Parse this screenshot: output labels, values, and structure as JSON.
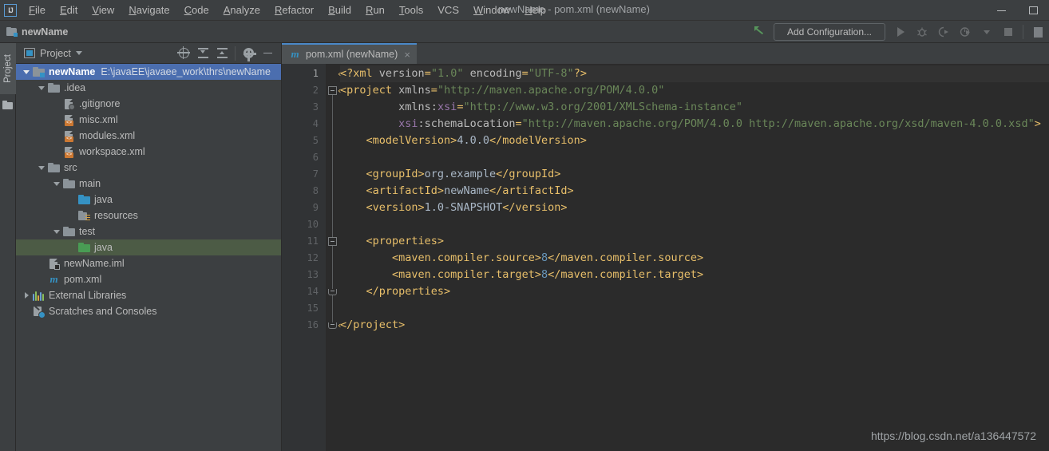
{
  "window": {
    "title": "newName - pom.xml (newName)",
    "logo": "intellij-idea-logo",
    "minimize": "−",
    "maximize": "□"
  },
  "menubar": {
    "items": [
      {
        "pre": "",
        "mn": "F",
        "post": "ile"
      },
      {
        "pre": "",
        "mn": "E",
        "post": "dit"
      },
      {
        "pre": "",
        "mn": "V",
        "post": "iew"
      },
      {
        "pre": "",
        "mn": "N",
        "post": "avigate"
      },
      {
        "pre": "",
        "mn": "C",
        "post": "ode"
      },
      {
        "pre": "",
        "mn": "A",
        "post": "nalyze"
      },
      {
        "pre": "",
        "mn": "R",
        "post": "efactor"
      },
      {
        "pre": "",
        "mn": "B",
        "post": "uild"
      },
      {
        "pre": "",
        "mn": "R",
        "post": "un"
      },
      {
        "pre": "",
        "mn": "T",
        "post": "ools"
      },
      {
        "pre": "VCS",
        "mn": "",
        "post": ""
      },
      {
        "pre": "",
        "mn": "W",
        "post": "indow"
      },
      {
        "pre": "",
        "mn": "H",
        "post": "elp"
      }
    ]
  },
  "navbar": {
    "breadcrumb": "newName",
    "add_configuration_label": "Add Configuration...",
    "icons": [
      "run-icon",
      "debug-icon",
      "run-with-coverage-icon",
      "profiler-icon",
      "chevron-down-icon",
      "stop-icon"
    ]
  },
  "project_panel": {
    "title": "Project",
    "toolbar_icons": [
      "locate-target-icon",
      "expand-all-icon",
      "collapse-all-icon",
      "settings-gear-icon",
      "hide-panel-icon"
    ],
    "tool_window_tab": "Project",
    "tree": [
      {
        "indent": 0,
        "twisty": "down",
        "icon": "module-icon",
        "label": "newName",
        "bold": true,
        "path": "E:\\javaEE\\javaee_work\\thrs\\newName",
        "state": "selected-blue"
      },
      {
        "indent": 1,
        "twisty": "down",
        "icon": "folder-icon",
        "label": ".idea",
        "state": "none"
      },
      {
        "indent": 2,
        "twisty": "none",
        "icon": "gitignore-file-icon",
        "label": ".gitignore",
        "state": "none"
      },
      {
        "indent": 2,
        "twisty": "none",
        "icon": "xml-file-icon",
        "label": "misc.xml",
        "state": "none"
      },
      {
        "indent": 2,
        "twisty": "none",
        "icon": "xml-file-icon",
        "label": "modules.xml",
        "state": "none"
      },
      {
        "indent": 2,
        "twisty": "none",
        "icon": "xml-file-icon",
        "label": "workspace.xml",
        "state": "none"
      },
      {
        "indent": 1,
        "twisty": "down",
        "icon": "folder-icon",
        "label": "src",
        "state": "none"
      },
      {
        "indent": 2,
        "twisty": "down",
        "icon": "folder-icon",
        "label": "main",
        "state": "none"
      },
      {
        "indent": 3,
        "twisty": "none",
        "icon": "source-folder-icon",
        "label": "java",
        "state": "none"
      },
      {
        "indent": 3,
        "twisty": "none",
        "icon": "resources-folder-icon",
        "label": "resources",
        "state": "none"
      },
      {
        "indent": 2,
        "twisty": "down",
        "icon": "folder-icon",
        "label": "test",
        "state": "none"
      },
      {
        "indent": 3,
        "twisty": "none",
        "icon": "test-source-folder-icon",
        "label": "java",
        "state": "selected-green"
      },
      {
        "indent": 1,
        "twisty": "none",
        "icon": "iml-file-icon",
        "label": "newName.iml",
        "state": "none"
      },
      {
        "indent": 1,
        "twisty": "none",
        "icon": "maven-pom-icon",
        "label": "pom.xml",
        "state": "none"
      },
      {
        "indent": 0,
        "twisty": "right",
        "icon": "external-libraries-icon",
        "label": "External Libraries",
        "state": "none"
      },
      {
        "indent": 0,
        "twisty": "none",
        "icon": "scratches-icon",
        "label": "Scratches and Consoles",
        "state": "none"
      }
    ]
  },
  "editor": {
    "tab": {
      "icon": "maven-pom-icon",
      "label": "pom.xml (newName)",
      "close": "×"
    },
    "line_numbers": [
      "1",
      "2",
      "3",
      "4",
      "5",
      "6",
      "7",
      "8",
      "9",
      "10",
      "11",
      "12",
      "13",
      "14",
      "15",
      "16"
    ],
    "active_line": 1,
    "lines": [
      {
        "n": 1,
        "indent": 0,
        "parts": [
          {
            "t": "pi",
            "v": "<?xml "
          },
          {
            "t": "attr",
            "v": "version"
          },
          {
            "t": "pi",
            "v": "="
          },
          {
            "t": "str",
            "v": "\"1.0\""
          },
          {
            "t": "pi",
            "v": " "
          },
          {
            "t": "attr",
            "v": "encoding"
          },
          {
            "t": "pi",
            "v": "="
          },
          {
            "t": "str",
            "v": "\"UTF-8\""
          },
          {
            "t": "pi",
            "v": "?>"
          }
        ]
      },
      {
        "n": 2,
        "indent": 0,
        "parts": [
          {
            "t": "tag",
            "v": "<project "
          },
          {
            "t": "attr",
            "v": "xmlns"
          },
          {
            "t": "tag",
            "v": "="
          },
          {
            "t": "str",
            "v": "\"http://maven.apache.org/POM/4.0.0\""
          }
        ]
      },
      {
        "n": 3,
        "indent": 0,
        "parts": [
          {
            "t": "txt",
            "v": "         "
          },
          {
            "t": "attr",
            "v": "xmlns:"
          },
          {
            "t": "ns",
            "v": "xsi"
          },
          {
            "t": "tag",
            "v": "="
          },
          {
            "t": "str",
            "v": "\"http://www.w3.org/2001/XMLSchema-instance\""
          }
        ]
      },
      {
        "n": 4,
        "indent": 0,
        "parts": [
          {
            "t": "txt",
            "v": "         "
          },
          {
            "t": "ns",
            "v": "xsi"
          },
          {
            "t": "attr",
            "v": ":schemaLocation"
          },
          {
            "t": "tag",
            "v": "="
          },
          {
            "t": "str",
            "v": "\"http://maven.apache.org/POM/4.0.0 http://maven.apache.org/xsd/maven-4.0.0.xsd\""
          },
          {
            "t": "tag",
            "v": ">"
          }
        ]
      },
      {
        "n": 5,
        "indent": 0,
        "parts": [
          {
            "t": "txt",
            "v": "    "
          },
          {
            "t": "tag",
            "v": "<modelVersion>"
          },
          {
            "t": "txt",
            "v": "4.0.0"
          },
          {
            "t": "tag",
            "v": "</modelVersion>"
          }
        ]
      },
      {
        "n": 6,
        "indent": 0,
        "parts": [
          {
            "t": "txt",
            "v": ""
          }
        ]
      },
      {
        "n": 7,
        "indent": 0,
        "parts": [
          {
            "t": "txt",
            "v": "    "
          },
          {
            "t": "tag",
            "v": "<groupId>"
          },
          {
            "t": "txt",
            "v": "org.example"
          },
          {
            "t": "tag",
            "v": "</groupId>"
          }
        ]
      },
      {
        "n": 8,
        "indent": 0,
        "parts": [
          {
            "t": "txt",
            "v": "    "
          },
          {
            "t": "tag",
            "v": "<artifactId>"
          },
          {
            "t": "txt",
            "v": "newName"
          },
          {
            "t": "tag",
            "v": "</artifactId>"
          }
        ]
      },
      {
        "n": 9,
        "indent": 0,
        "parts": [
          {
            "t": "txt",
            "v": "    "
          },
          {
            "t": "tag",
            "v": "<version>"
          },
          {
            "t": "txt",
            "v": "1.0-SNAPSHOT"
          },
          {
            "t": "tag",
            "v": "</version>"
          }
        ]
      },
      {
        "n": 10,
        "indent": 0,
        "parts": [
          {
            "t": "txt",
            "v": ""
          }
        ]
      },
      {
        "n": 11,
        "indent": 0,
        "parts": [
          {
            "t": "txt",
            "v": "    "
          },
          {
            "t": "tag",
            "v": "<properties>"
          }
        ]
      },
      {
        "n": 12,
        "indent": 0,
        "parts": [
          {
            "t": "txt",
            "v": "        "
          },
          {
            "t": "tag",
            "v": "<maven.compiler.source>"
          },
          {
            "t": "num",
            "v": "8"
          },
          {
            "t": "tag",
            "v": "</maven.compiler.source>"
          }
        ]
      },
      {
        "n": 13,
        "indent": 0,
        "parts": [
          {
            "t": "txt",
            "v": "        "
          },
          {
            "t": "tag",
            "v": "<maven.compiler.target>"
          },
          {
            "t": "num",
            "v": "8"
          },
          {
            "t": "tag",
            "v": "</maven.compiler.target>"
          }
        ]
      },
      {
        "n": 14,
        "indent": 0,
        "parts": [
          {
            "t": "txt",
            "v": "    "
          },
          {
            "t": "tag",
            "v": "</properties>"
          }
        ]
      },
      {
        "n": 15,
        "indent": 0,
        "parts": [
          {
            "t": "txt",
            "v": ""
          }
        ]
      },
      {
        "n": 16,
        "indent": 0,
        "parts": [
          {
            "t": "tag",
            "v": "</project>"
          }
        ]
      }
    ],
    "fold_markers": [
      {
        "line": 2,
        "kind": "open"
      },
      {
        "line": 11,
        "kind": "open"
      },
      {
        "line": 14,
        "kind": "end"
      },
      {
        "line": 16,
        "kind": "end"
      }
    ]
  },
  "watermark": "https://blog.csdn.net/a136447572",
  "colors": {
    "panel_bg": "#3c3f41",
    "editor_bg": "#2b2b2b",
    "gutter_bg": "#313335",
    "selection_blue": "#4b6eaf",
    "selection_green": "#4c5b45",
    "tag": "#e8bf6a",
    "string": "#6a8759",
    "namespace": "#9876aa",
    "number": "#6897bb",
    "text": "#a9b7c6",
    "accent_blue": "#3592c4"
  }
}
